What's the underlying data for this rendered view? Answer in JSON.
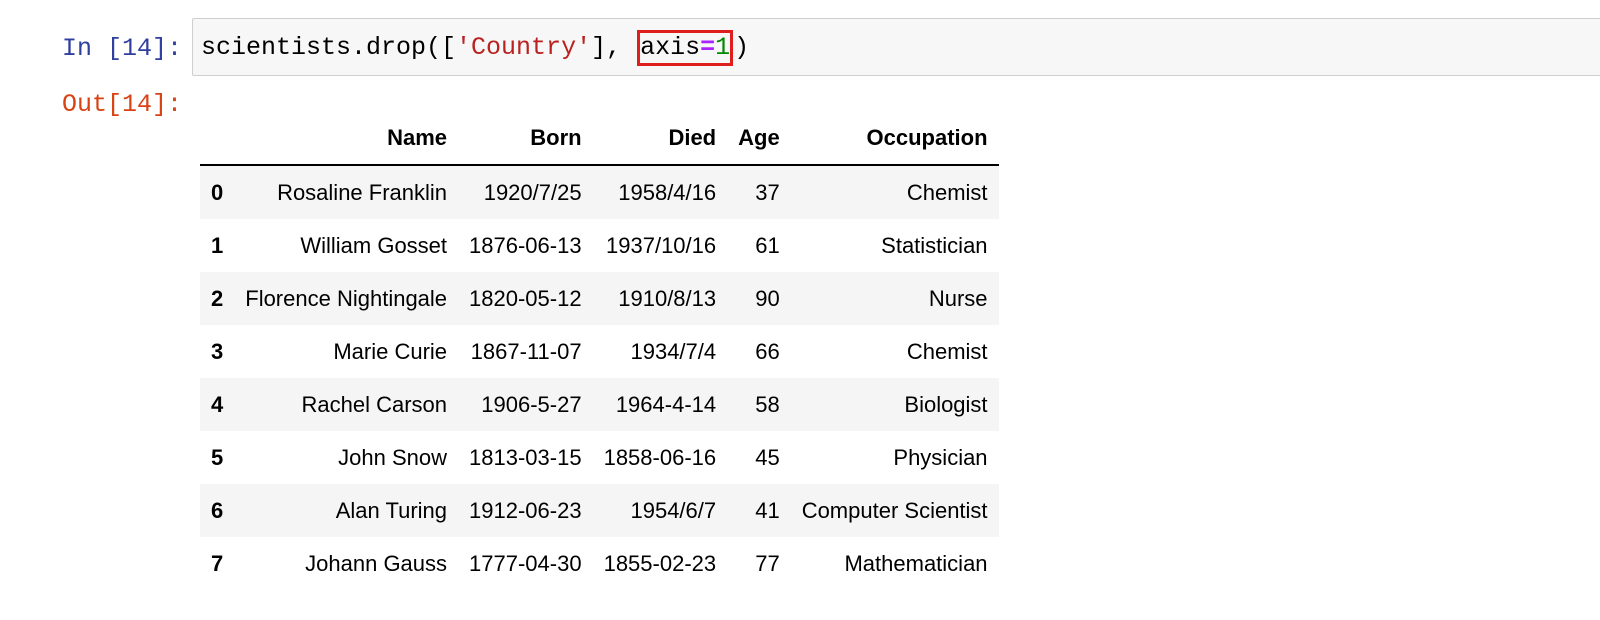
{
  "cell": {
    "in_prompt": "In [14]:",
    "out_prompt": "Out[14]:",
    "code": {
      "part1": "scientists.drop([",
      "string": "'Country'",
      "part2": "],",
      "kw": "axis",
      "op": "=",
      "num": "1",
      "close": ")"
    },
    "highlight_color": "#e01e1e"
  },
  "table": {
    "columns": [
      "",
      "Name",
      "Born",
      "Died",
      "Age",
      "Occupation"
    ],
    "rows": [
      {
        "index": "0",
        "Name": "Rosaline Franklin",
        "Born": "1920/7/25",
        "Died": "1958/4/16",
        "Age": "37",
        "Occupation": "Chemist"
      },
      {
        "index": "1",
        "Name": "William Gosset",
        "Born": "1876-06-13",
        "Died": "1937/10/16",
        "Age": "61",
        "Occupation": "Statistician"
      },
      {
        "index": "2",
        "Name": "Florence Nightingale",
        "Born": "1820-05-12",
        "Died": "1910/8/13",
        "Age": "90",
        "Occupation": "Nurse"
      },
      {
        "index": "3",
        "Name": "Marie Curie",
        "Born": "1867-11-07",
        "Died": "1934/7/4",
        "Age": "66",
        "Occupation": "Chemist"
      },
      {
        "index": "4",
        "Name": "Rachel Carson",
        "Born": "1906-5-27",
        "Died": "1964-4-14",
        "Age": "58",
        "Occupation": "Biologist"
      },
      {
        "index": "5",
        "Name": "John Snow",
        "Born": "1813-03-15",
        "Died": "1858-06-16",
        "Age": "45",
        "Occupation": "Physician"
      },
      {
        "index": "6",
        "Name": "Alan Turing",
        "Born": "1912-06-23",
        "Died": "1954/6/7",
        "Age": "41",
        "Occupation": "Computer Scientist"
      },
      {
        "index": "7",
        "Name": "Johann Gauss",
        "Born": "1777-04-30",
        "Died": "1855-02-23",
        "Age": "77",
        "Occupation": "Mathematician"
      }
    ]
  }
}
